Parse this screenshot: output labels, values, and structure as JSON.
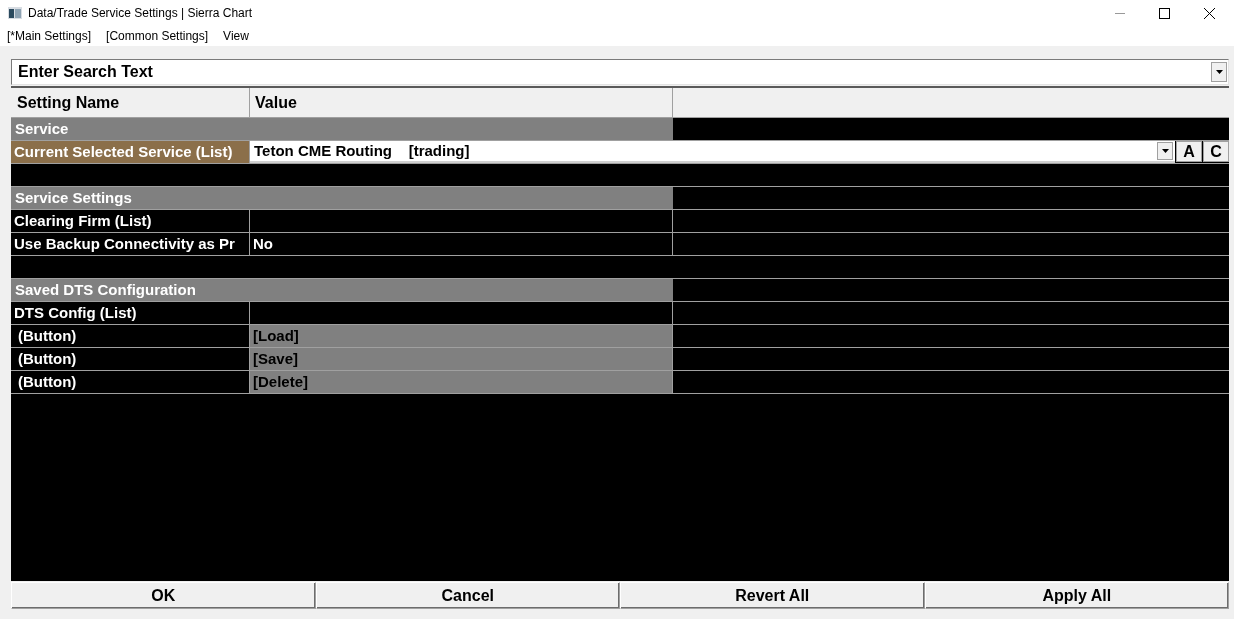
{
  "window": {
    "title": "Data/Trade Service Settings | Sierra Chart"
  },
  "menu": [
    {
      "label": "[*Main Settings]"
    },
    {
      "label": "[Common Settings]"
    },
    {
      "label": "View"
    }
  ],
  "search": {
    "placeholder": "Enter Search Text"
  },
  "table": {
    "columns": [
      "Setting Name",
      "Value"
    ],
    "rows": [
      {
        "kind": "group",
        "name": "Service"
      },
      {
        "kind": "setting",
        "name": "Current Selected Service (List)",
        "value": "Teton CME Routing    [trading]",
        "selected": true,
        "buttons": [
          "A",
          "C"
        ]
      },
      {
        "kind": "blank"
      },
      {
        "kind": "group",
        "name": "Service Settings"
      },
      {
        "kind": "setting",
        "name": "Clearing Firm (List)",
        "selected": false
      },
      {
        "kind": "setting",
        "name": "Use Backup Connectivity as Pr",
        "value": "No",
        "selected": false
      },
      {
        "kind": "blank"
      },
      {
        "kind": "group",
        "name": "Saved DTS Configuration"
      },
      {
        "kind": "setting",
        "name": "DTS Config (List)",
        "selected": false
      },
      {
        "kind": "button",
        "name": "(Button)",
        "value": "[Load]",
        "selected": false
      },
      {
        "kind": "button",
        "name": "(Button)",
        "value": "[Save]",
        "selected": false
      },
      {
        "kind": "button",
        "name": "(Button)",
        "value": "[Delete]",
        "selected": false
      }
    ]
  },
  "footer_buttons": [
    "OK",
    "Cancel",
    "Revert All",
    "Apply All"
  ]
}
